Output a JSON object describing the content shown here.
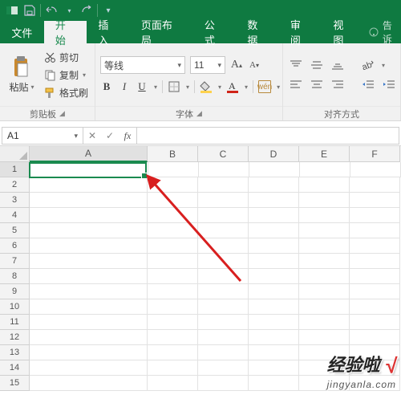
{
  "titlebar": {
    "qat": [
      "save-icon",
      "undo-icon",
      "redo-icon",
      "customize-qat-icon"
    ]
  },
  "tabs": {
    "file": "文件",
    "items": [
      "开始",
      "插入",
      "页面布局",
      "公式",
      "数据",
      "审阅",
      "视图"
    ],
    "active_index": 0,
    "tell_me_prefix": "告诉"
  },
  "ribbon": {
    "clipboard": {
      "paste": "粘贴",
      "cut": "剪切",
      "copy": "复制",
      "format_painter": "格式刷",
      "group_label": "剪贴板"
    },
    "font": {
      "font_name": "等线",
      "font_size": "11",
      "wen_label": "wén",
      "group_label": "字体"
    },
    "alignment": {
      "group_label": "对齐方式"
    }
  },
  "namebox": {
    "value": "A1"
  },
  "fx_label": "fx",
  "grid": {
    "columns": [
      "A",
      "B",
      "C",
      "D",
      "E",
      "F"
    ],
    "active_col_index": 0,
    "rows": [
      1,
      2,
      3,
      4,
      5,
      6,
      7,
      8,
      9,
      10,
      11,
      12,
      13,
      14,
      15
    ],
    "active_row_index": 0
  },
  "watermark": {
    "line1": "经验啦",
    "check": "√",
    "line2": "jingyanla.com"
  }
}
